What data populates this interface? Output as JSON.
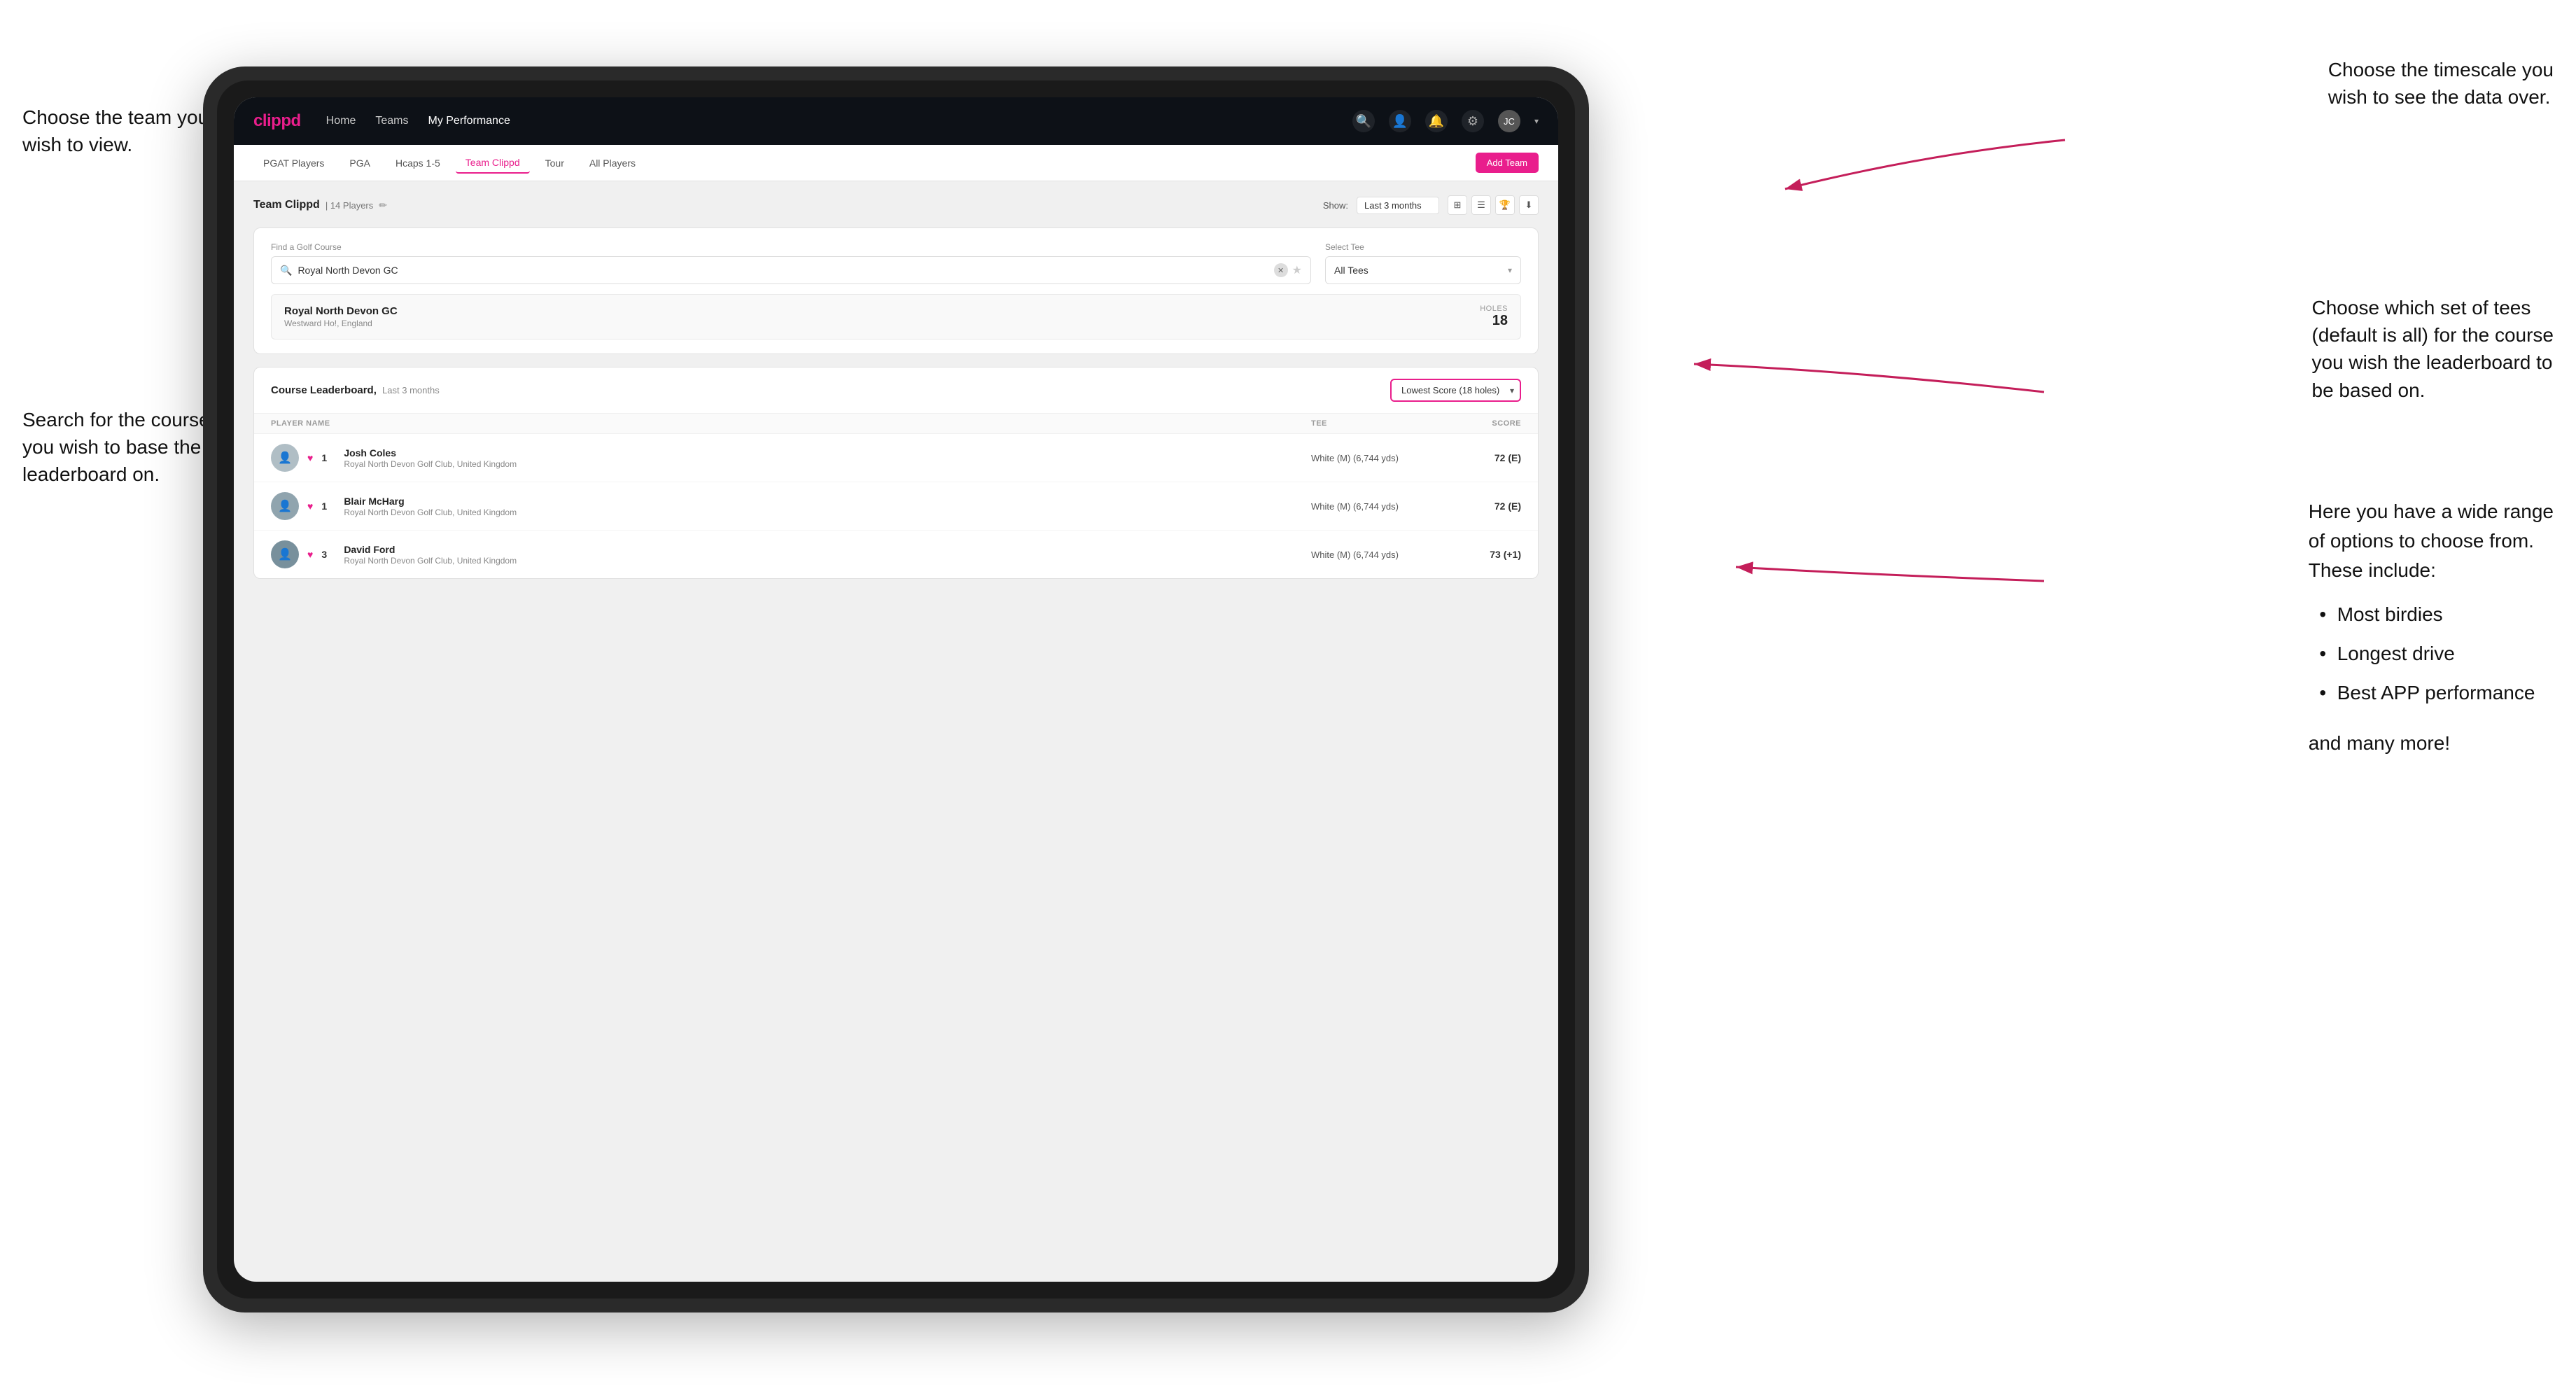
{
  "annotations": {
    "top_left": {
      "title": "Choose the team you wish to view.",
      "top_right": "Choose the timescale you wish to see the data over.",
      "bottom_left_search": "Search for the course you wish to base the leaderboard on.",
      "bottom_right_tee": "Choose which set of tees (default is all) for the course you wish the leaderboard to be based on.",
      "score_options_title": "Here you have a wide range of options to choose from. These include:",
      "score_options": [
        "Most birdies",
        "Longest drive",
        "Best APP performance"
      ],
      "score_options_footer": "and many more!"
    }
  },
  "app": {
    "logo": "clippd",
    "nav": {
      "items": [
        {
          "label": "Home",
          "active": false
        },
        {
          "label": "Teams",
          "active": false
        },
        {
          "label": "My Performance",
          "active": true
        }
      ],
      "icons": [
        "search",
        "person",
        "bell",
        "settings",
        "avatar"
      ]
    },
    "sub_nav": {
      "items": [
        {
          "label": "PGAT Players",
          "active": false
        },
        {
          "label": "PGA",
          "active": false
        },
        {
          "label": "Hcaps 1-5",
          "active": false
        },
        {
          "label": "Team Clippd",
          "active": true
        },
        {
          "label": "Tour",
          "active": false
        },
        {
          "label": "All Players",
          "active": false
        }
      ],
      "add_team_label": "Add Team"
    },
    "main": {
      "team_title": "Team Clippd",
      "team_players": "14 Players",
      "show_label": "Show:",
      "show_value": "Last 3 months",
      "search": {
        "label": "Find a Golf Course",
        "placeholder": "Royal North Devon GC",
        "value": "Royal North Devon GC"
      },
      "tee": {
        "label": "Select Tee",
        "value": "All Tees"
      },
      "course_result": {
        "name": "Royal North Devon GC",
        "location": "Westward Ho!, England",
        "holes_label": "Holes",
        "holes": "18"
      },
      "leaderboard": {
        "title": "Course Leaderboard,",
        "subtitle": "Last 3 months",
        "score_type": "Lowest Score (18 holes)",
        "columns": {
          "player": "PLAYER NAME",
          "tee": "TEE",
          "score": "SCORE"
        },
        "players": [
          {
            "rank": "1",
            "name": "Josh Coles",
            "club": "Royal North Devon Golf Club, United Kingdom",
            "tee": "White (M) (6,744 yds)",
            "score": "72 (E)"
          },
          {
            "rank": "1",
            "name": "Blair McHarg",
            "club": "Royal North Devon Golf Club, United Kingdom",
            "tee": "White (M) (6,744 yds)",
            "score": "72 (E)"
          },
          {
            "rank": "3",
            "name": "David Ford",
            "club": "Royal North Devon Golf Club, United Kingdom",
            "tee": "White (M) (6,744 yds)",
            "score": "73 (+1)"
          }
        ]
      }
    }
  },
  "icons": {
    "search": "🔍",
    "person": "👤",
    "bell": "🔔",
    "settings": "⚙",
    "chevron_down": "▾",
    "edit": "✏",
    "grid": "⊞",
    "list": "☰",
    "trophy": "🏆",
    "download": "⬇",
    "star": "★",
    "heart": "♥",
    "clear": "✕"
  }
}
